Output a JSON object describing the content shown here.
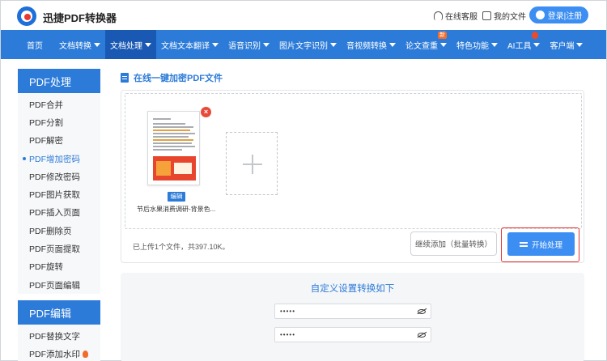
{
  "header": {
    "brand": "迅捷PDF转换器",
    "support_label": "在线客服",
    "my_files_label": "我的文件",
    "login_label": "登录|注册"
  },
  "nav": {
    "items": [
      {
        "label": "首页",
        "caret": false
      },
      {
        "label": "文档转换",
        "caret": true
      },
      {
        "label": "文档处理",
        "caret": true,
        "active": true
      },
      {
        "label": "文档文本翻译",
        "caret": true
      },
      {
        "label": "语音识别",
        "caret": true
      },
      {
        "label": "图片文字识别",
        "caret": true
      },
      {
        "label": "音视频转换",
        "caret": true
      },
      {
        "label": "论文查重",
        "caret": true,
        "badge": "新"
      },
      {
        "label": "特色功能",
        "caret": true
      },
      {
        "label": "AI工具",
        "caret": true,
        "badge_icon": "fire-icon"
      },
      {
        "label": "客户端",
        "caret": true
      }
    ]
  },
  "sidebar": {
    "section1_title": "PDF处理",
    "section1_items": [
      "PDF合并",
      "PDF分割",
      "PDF解密",
      "PDF增加密码",
      "PDF修改密码",
      "PDF图片获取",
      "PDF插入页面",
      "PDF删除页",
      "PDF页面提取",
      "PDF旋转",
      "PDF页面编辑"
    ],
    "active_index": 3,
    "section2_title": "PDF编辑",
    "section2_items": [
      "PDF替换文字",
      "PDF添加水印"
    ]
  },
  "main": {
    "title": "在线一键加密PDF文件",
    "file": {
      "name": "节后水果消费调研-背景色...",
      "edit_label": "编辑"
    },
    "status": "已上传1个文件，共397.10K。",
    "continue_label": "继续添加（批量转换）",
    "start_label": "开始处理"
  },
  "settings": {
    "title": "自定义设置转换如下",
    "password_value": "•••••",
    "confirm_value": "•••••"
  },
  "colors": {
    "primary": "#2c7bd8",
    "button": "#3c8ef2",
    "highlight": "#e5322d"
  }
}
